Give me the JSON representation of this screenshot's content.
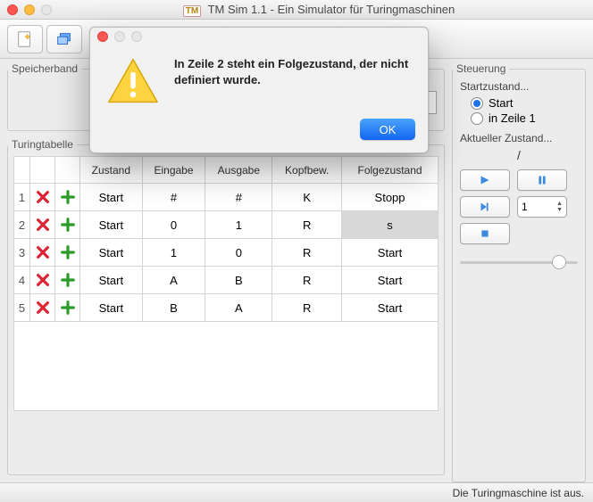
{
  "window": {
    "title": "TM Sim 1.1 - Ein Simulator für Turingmaschinen",
    "badge": "TM"
  },
  "sections": {
    "tape": "Speicherband",
    "table": "Turingtabelle",
    "control": "Steuerung"
  },
  "tape_visible": [
    "#",
    "#"
  ],
  "table": {
    "headers": [
      "",
      "",
      "",
      "Zustand",
      "Eingabe",
      "Ausgabe",
      "Kopfbew.",
      "Folgezustand"
    ],
    "rows": [
      {
        "n": "1",
        "state": "Start",
        "in": "#",
        "out": "#",
        "move": "K",
        "next": "Stopp",
        "hl": false
      },
      {
        "n": "2",
        "state": "Start",
        "in": "0",
        "out": "1",
        "move": "R",
        "next": "s",
        "hl": true
      },
      {
        "n": "3",
        "state": "Start",
        "in": "1",
        "out": "0",
        "move": "R",
        "next": "Start",
        "hl": false
      },
      {
        "n": "4",
        "state": "Start",
        "in": "A",
        "out": "B",
        "move": "R",
        "next": "Start",
        "hl": false
      },
      {
        "n": "5",
        "state": "Start",
        "in": "B",
        "out": "A",
        "move": "R",
        "next": "Start",
        "hl": false
      }
    ]
  },
  "control": {
    "startLabel": "Startzustand...",
    "opt1": "Start",
    "opt2": "in Zeile 1",
    "curLabel": "Aktueller Zustand...",
    "curValue": "/",
    "stepValue": "1"
  },
  "status": "Die Turingmaschine ist aus.",
  "dialog": {
    "message": "In Zeile 2 steht ein Folgezustand, der nicht definiert wurde.",
    "ok": "OK"
  }
}
